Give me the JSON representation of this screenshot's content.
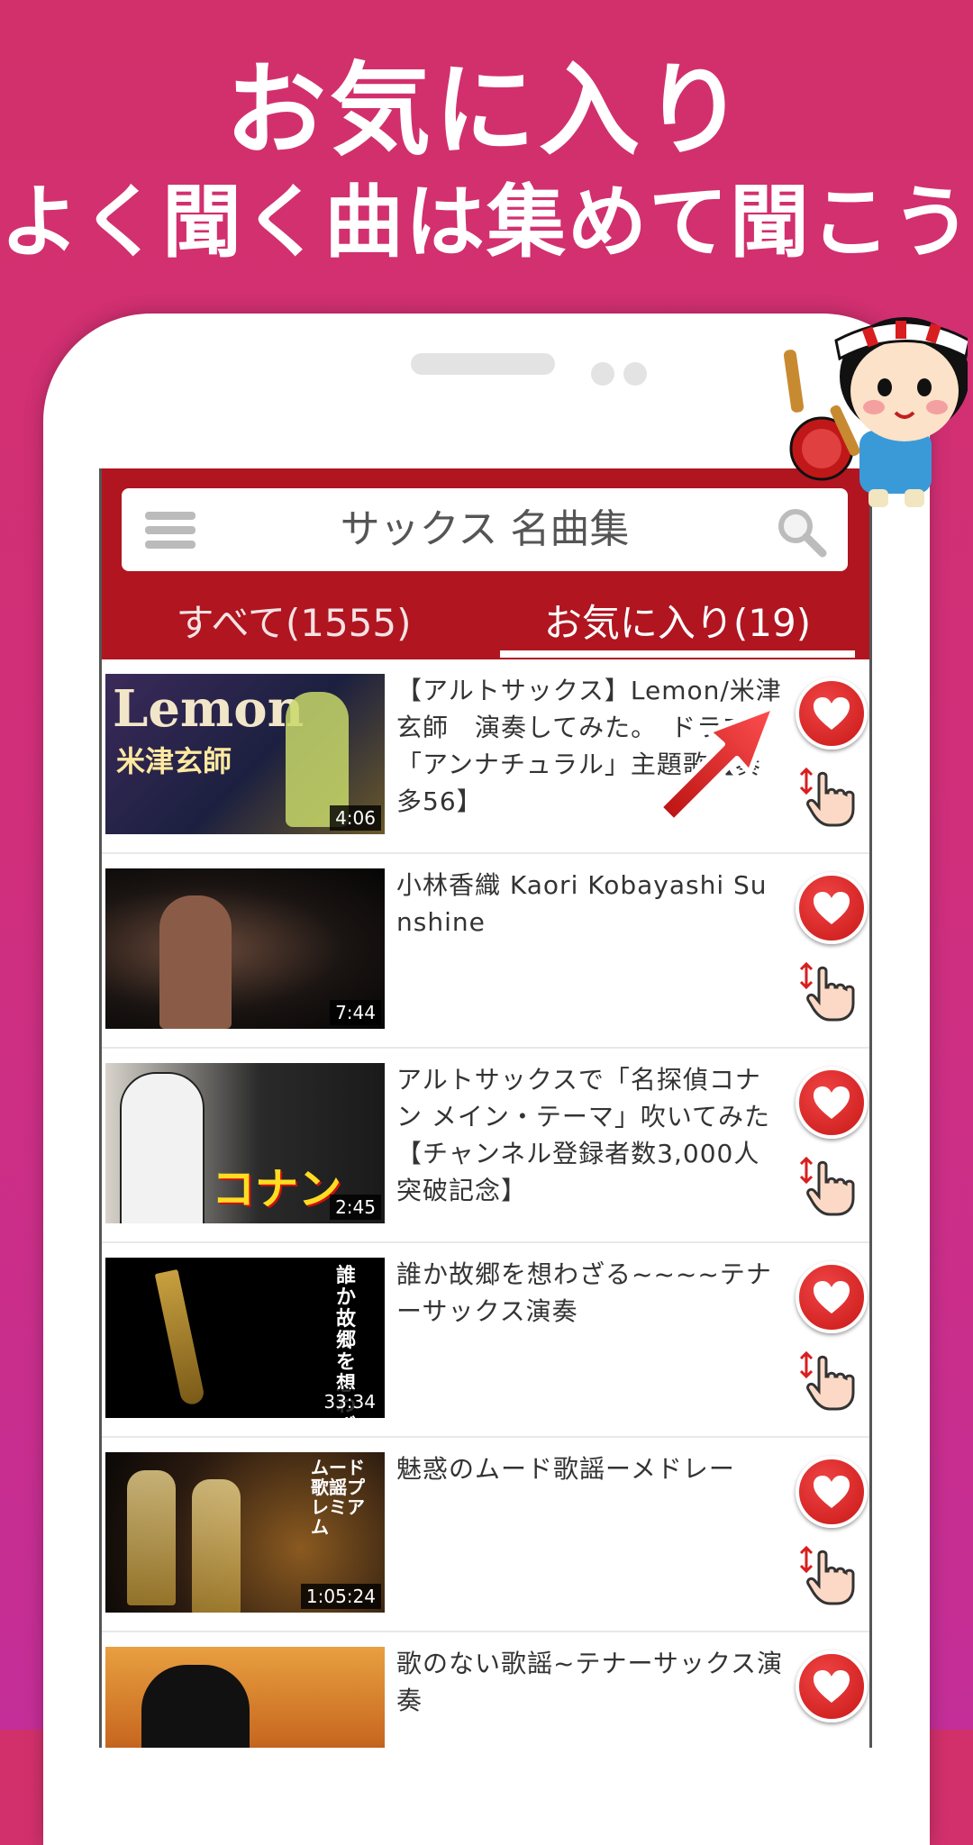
{
  "promo": {
    "line1": "お気に入り",
    "line2": "よく聞く曲は集めて聞こう"
  },
  "app": {
    "search_text": "サックス 名曲集",
    "tabs": [
      {
        "label": "すべて(1555)",
        "selected": false
      },
      {
        "label": "お気に入り(19)",
        "selected": true
      }
    ],
    "colors": {
      "appbar": "#b01520",
      "heart": "#d81e1e",
      "background_top": "#d2306a",
      "background_bottom": "#c42e98"
    }
  },
  "videos": [
    {
      "title": "【アルトサックス】Lemon/米津玄師　演奏してみた。　ドラマ「アンナチュラル」主題歌【奏多56】",
      "duration": "4:06",
      "thumb_text": "Lemon",
      "thumb_subtext": "米津玄師"
    },
    {
      "title": "小林香織 Kaori Kobayashi Sunshine",
      "duration": "7:44"
    },
    {
      "title": "アルトサックスで「名探偵コナン メイン・テーマ」吹いてみた【チャンネル登録者数3,000人突破記念】",
      "duration": "2:45",
      "thumb_text": "コナン"
    },
    {
      "title": "誰か故郷を想わざる~~~~テナーサックス演奏",
      "duration": "33:34",
      "thumb_text": "誰か故郷を想わざる"
    },
    {
      "title": "魅惑のムード歌謡ーメドレー",
      "duration": "1:05:24",
      "thumb_text": "ムード歌謡プレミアム"
    },
    {
      "title": "歌のない歌謡~テナーサックス演奏",
      "duration": ""
    }
  ],
  "icons": [
    "hamburger-icon",
    "search-icon",
    "heart-icon",
    "drag-hand-icon",
    "pointer-arrow-icon",
    "mascot-character"
  ]
}
